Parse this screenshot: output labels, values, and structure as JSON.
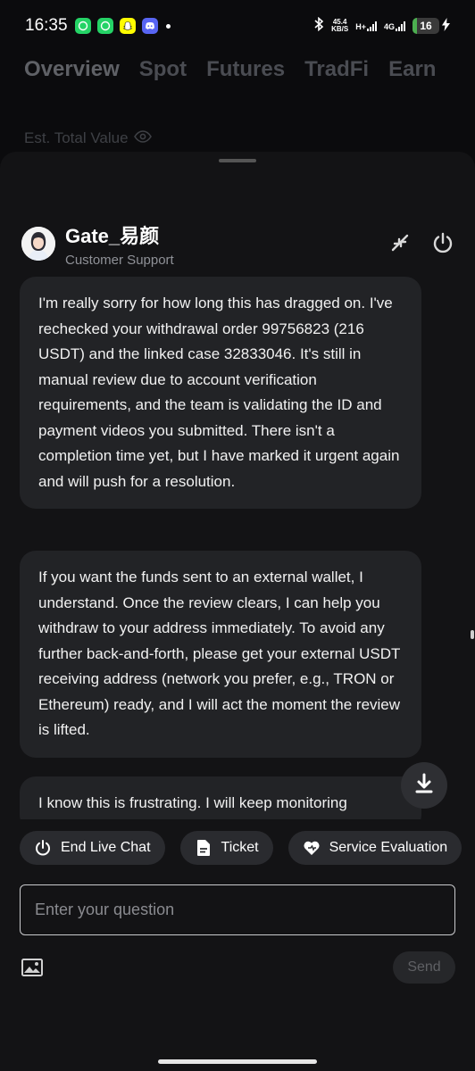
{
  "status_bar": {
    "time": "16:35",
    "net_speed_value": "45.4",
    "net_speed_unit": "KB/S",
    "network_1": "H+",
    "network_2": "4G",
    "battery": "16",
    "battery_level_percent": 16
  },
  "background": {
    "tabs": [
      "Overview",
      "Spot",
      "Futures",
      "TradFi",
      "Earn"
    ],
    "active_tab": "Overview",
    "est_label": "Est. Total Value"
  },
  "chat_header": {
    "agent_name": "Gate_易颜",
    "agent_role": "Customer Support",
    "minimize_icon": "collapse-icon",
    "power_icon": "power-icon"
  },
  "messages": [
    {
      "text": "I'm really sorry for how long this has dragged on. I've rechecked your withdrawal order 99756823 (216 USDT) and the linked case 32833046. It's still in manual review due to account verification requirements, and the team is validating the ID and payment videos you submitted. There isn't a completion time yet, but I have marked it urgent again and will push for a resolution."
    },
    {
      "text": "If you want the funds sent to an external wallet, I understand. Once the review clears, I can help you withdraw to your address immediately. To avoid any further back-and-forth, please get your external USDT receiving address (network you prefer, e.g., TRON or Ethereum) ready, and I will act the moment the review is lifted."
    },
    {
      "text": "I know this is frustrating. I will keep monitoring"
    }
  ],
  "quick_actions": [
    {
      "label": "End Live Chat",
      "icon": "power-icon"
    },
    {
      "label": "Ticket",
      "icon": "document-icon"
    },
    {
      "label": "Service Evaluation",
      "icon": "heart-icon"
    }
  ],
  "composer": {
    "placeholder": "Enter your question",
    "value": "",
    "send_label": "Send",
    "image_icon": "image-icon"
  },
  "colors": {
    "background": "#0b0b0d",
    "sheet": "#131315",
    "bubble": "#222326",
    "chip": "#2a2b2f"
  }
}
